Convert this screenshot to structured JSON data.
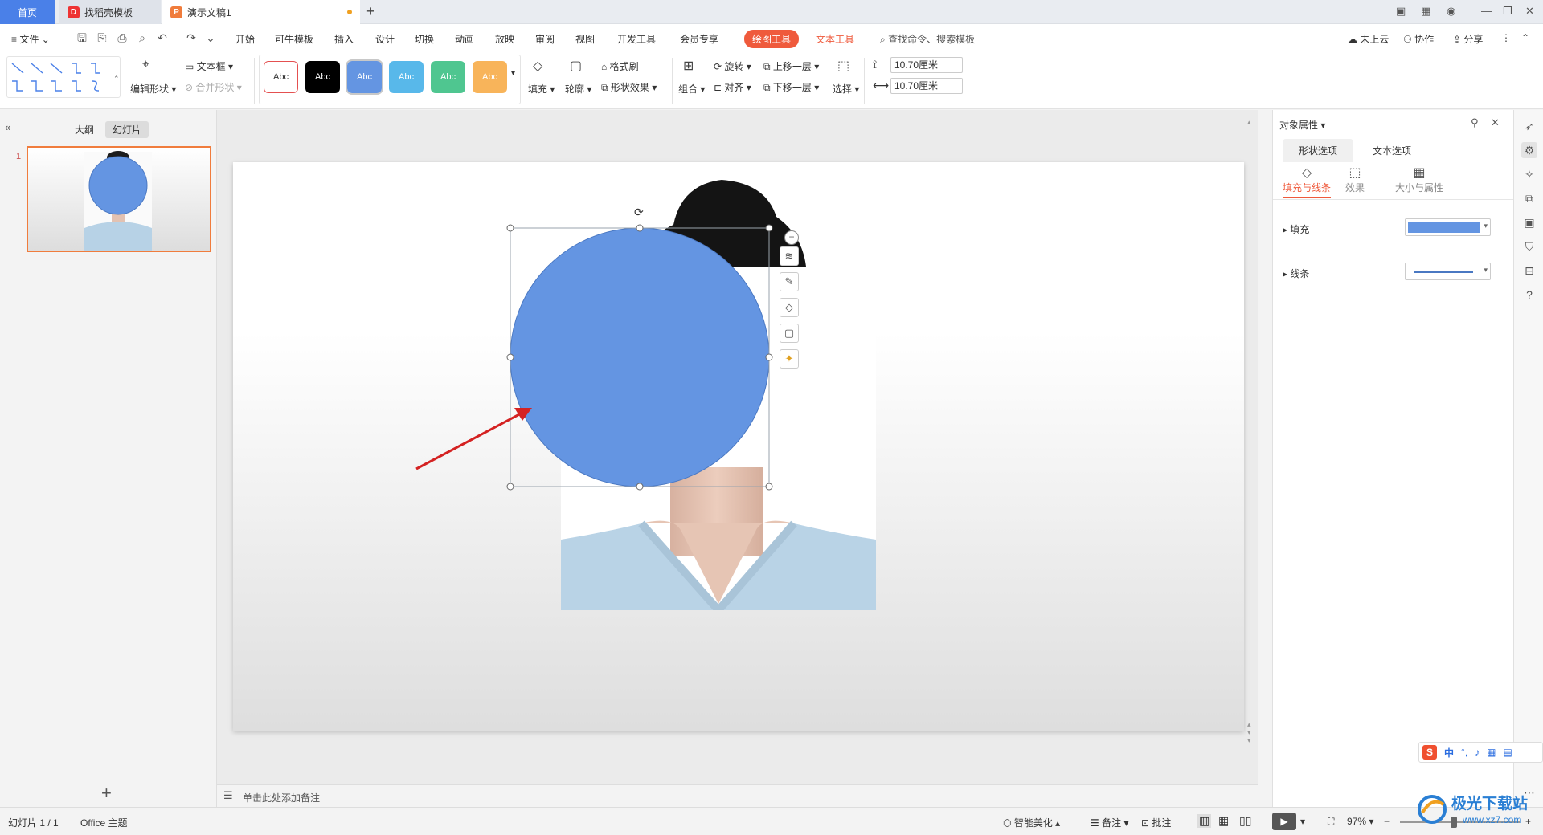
{
  "titlebar": {
    "tabs": [
      {
        "label": "首页",
        "active": false
      },
      {
        "label": "找稻壳模板",
        "active": false
      },
      {
        "label": "演示文稿1",
        "active": true
      }
    ],
    "new_tab": "+"
  },
  "menubar": {
    "file": "文件",
    "items": [
      "开始",
      "可牛模板",
      "插入",
      "设计",
      "切换",
      "动画",
      "放映",
      "审阅",
      "视图",
      "开发工具",
      "会员专享"
    ],
    "active_tool": "绘图工具",
    "text_tool": "文本工具",
    "search_placeholder": "查找命令、搜索模板",
    "cloud": "未上云",
    "collab": "协作",
    "share": "分享"
  },
  "ribbon": {
    "edit_shape": "编辑形状",
    "textbox": "文本框",
    "merge_shape": "合并形状",
    "style_presets": [
      "Abc",
      "Abc",
      "Abc",
      "Abc",
      "Abc",
      "Abc"
    ],
    "fill": "填充",
    "outline": "轮廓",
    "format_painter": "格式刷",
    "shape_effects": "形状效果",
    "group": "组合",
    "rotate": "旋转",
    "align": "对齐",
    "bring_forward": "上移一层",
    "send_backward": "下移一层",
    "select": "选择",
    "height": "10.70厘米",
    "width": "10.70厘米"
  },
  "leftpanel": {
    "outline_tab": "大纲",
    "slides_tab": "幻灯片",
    "slide_number": "1",
    "add": "+"
  },
  "notes": {
    "placeholder": "单击此处添加备注"
  },
  "rightpanel": {
    "title": "对象属性",
    "tab_shape": "形状选项",
    "tab_text": "文本选项",
    "sub_fill_line": "填充与线条",
    "sub_effect": "效果",
    "sub_size": "大小与属性",
    "fill_label": "填充",
    "line_label": "线条",
    "fill_color": "#6495e2"
  },
  "statusbar": {
    "slide_info": "幻灯片 1 / 1",
    "theme": "Office 主题",
    "beautify": "智能美化",
    "notes": "备注",
    "comments": "批注",
    "zoom": "97%"
  },
  "watermark": {
    "site": "极光下载站",
    "url": "www.xz7.com"
  },
  "ime": {
    "lang": "中"
  },
  "colors": {
    "accent": "#ef5a3c",
    "circle": "#6495e2",
    "home_tab": "#4a80e8",
    "arrow": "#d42222"
  }
}
